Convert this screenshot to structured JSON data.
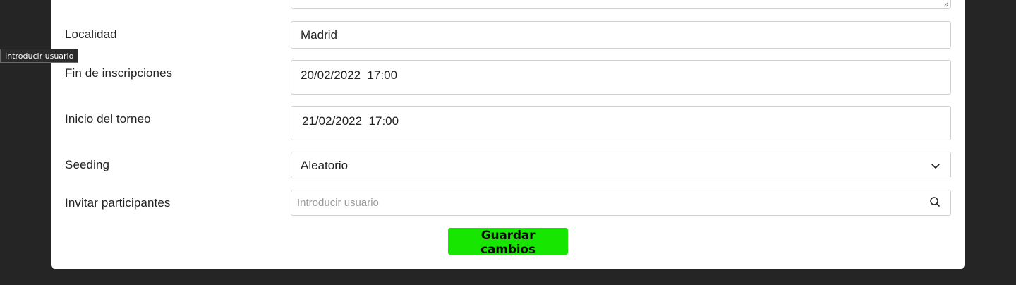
{
  "form": {
    "locality": {
      "label": "Localidad",
      "value": "Madrid"
    },
    "registration_end": {
      "label": "Fin de inscripciones",
      "value": "20/02/2022  17:00"
    },
    "tournament_start": {
      "label": "Inicio del torneo",
      "value": "21/02/2022  17:00"
    },
    "seeding": {
      "label": "Seeding",
      "value": "Aleatorio"
    },
    "invite": {
      "label": "Invitar participantes",
      "placeholder": "Introducir usuario"
    },
    "save_label": "Guardar cambios"
  },
  "tooltip": {
    "text": "Introducir usuario"
  },
  "colors": {
    "background": "#252525",
    "card": "#ffffff",
    "accent_button": "#16e600",
    "field_border": "#cfcfcf"
  },
  "icons": {
    "select": "chevron-down-icon",
    "search": "search-icon",
    "textarea": "resize-grip-icon"
  }
}
